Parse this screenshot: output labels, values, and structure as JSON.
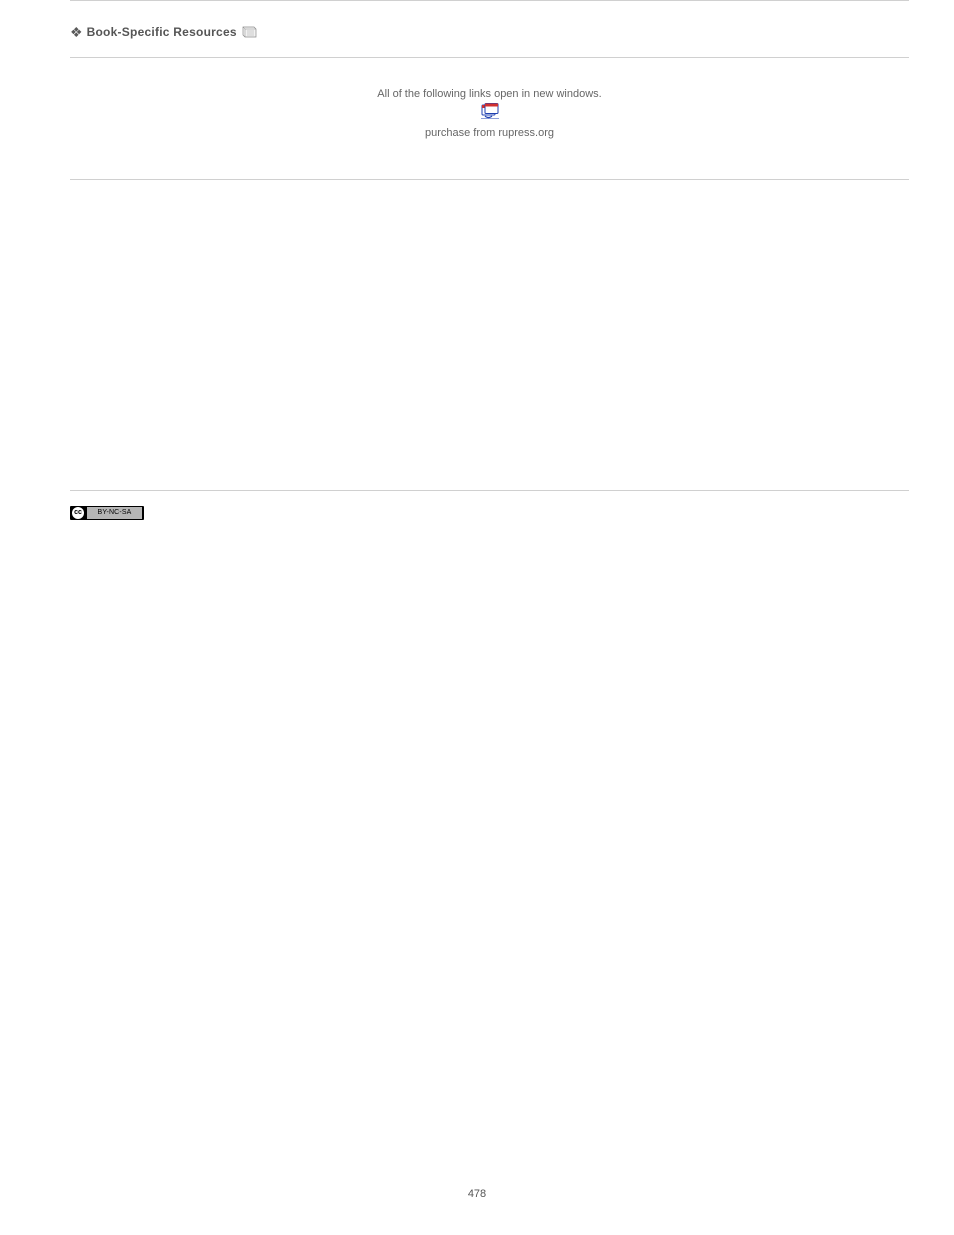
{
  "section": {
    "title": "Book-Specific Resources"
  },
  "mid": {
    "top": "All of the following links open in new windows.",
    "bottom": "purchase from rupress.org"
  },
  "license": {
    "short": "cc",
    "label": "BY-NC-SA"
  },
  "page_number": "478"
}
